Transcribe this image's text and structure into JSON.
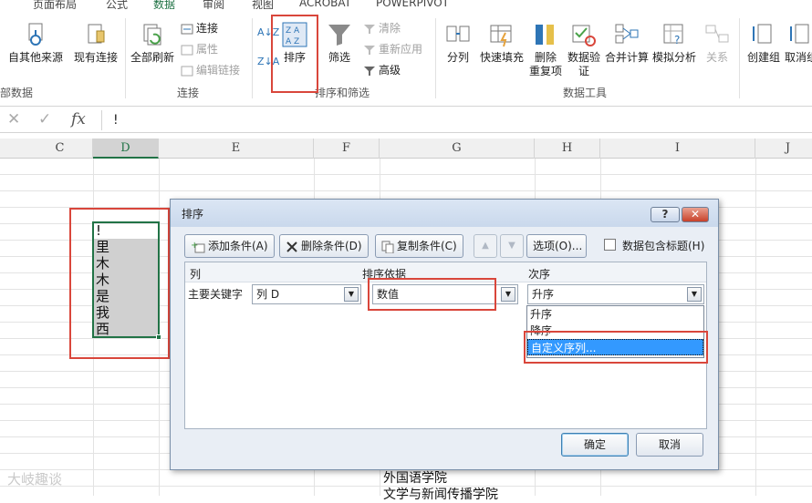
{
  "tabs": [
    "页面布局",
    "公式",
    "数据",
    "审阅",
    "视图",
    "ACROBAT",
    "POWERPIVOT"
  ],
  "ribbon": {
    "get_external": {
      "other_sources": "自其他来源",
      "existing": "现有连接",
      "label": "部数据"
    },
    "connections": {
      "refresh_all": "全部刷新",
      "conn": "连接",
      "props": "属性",
      "edit_links": "编辑链接",
      "label": "连接"
    },
    "sort_filter": {
      "sort": "排序",
      "filter": "筛选",
      "clear": "清除",
      "reapply": "重新应用",
      "advanced": "高级",
      "label": "排序和筛选",
      "az": "A↓Z",
      "za": "Z↓A"
    },
    "data_tools": {
      "split": "分列",
      "flash": "快速填充",
      "remove_dup_1": "删除",
      "remove_dup_2": "重复项",
      "validate_1": "数据验",
      "validate_2": "证",
      "consolidate": "合并计算",
      "whatif": "模拟分析",
      "relations": "关系",
      "label": "数据工具"
    },
    "outline": {
      "group": "创建组",
      "ungroup": "取消组"
    }
  },
  "formula_bar": {
    "cancel": "✕",
    "enter": "✓",
    "fx": "fx",
    "content": "!"
  },
  "columns": [
    "C",
    "D",
    "E",
    "F",
    "G",
    "H",
    "I",
    "J"
  ],
  "cells_d": [
    "!",
    "里",
    "木",
    "木",
    "是",
    "我",
    "西"
  ],
  "dialog": {
    "title": "排序",
    "help": "?",
    "close": "✕",
    "add": "添加条件(A)",
    "delete": "删除条件(D)",
    "copy": "复制条件(C)",
    "up": "▲",
    "down": "▼",
    "options": "选项(O)...",
    "has_headers": "数据包含标题(H)",
    "col_header": "列",
    "basis_header": "排序依据",
    "order_header": "次序",
    "primary_key": "主要关键字",
    "column_value": "列 D",
    "basis_value": "数值",
    "order_value": "升序",
    "order_options": [
      "升序",
      "降序",
      "自定义序列..."
    ],
    "ok": "确定",
    "cancel": "取消"
  },
  "bottom": [
    "外国语学院",
    "文学与新闻传播学院"
  ],
  "watermark": "大岐趣谈"
}
